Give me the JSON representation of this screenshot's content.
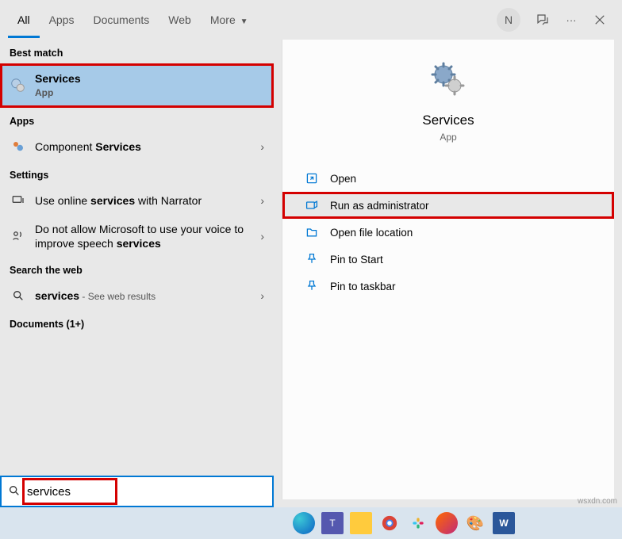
{
  "tabs": {
    "all": "All",
    "apps": "Apps",
    "documents": "Documents",
    "web": "Web",
    "more": "More"
  },
  "avatar_initial": "N",
  "ellipsis": "···",
  "left": {
    "best_match": "Best match",
    "best": {
      "title": "Services",
      "sub": "App"
    },
    "apps_label": "Apps",
    "apps_item": {
      "pre": "Component ",
      "hl": "Services"
    },
    "settings_label": "Settings",
    "settings_1": {
      "pre": "Use online ",
      "hl": "services",
      "post": " with Narrator"
    },
    "settings_2": {
      "pre": "Do not allow Microsoft to use your voice to improve speech ",
      "hl": "services"
    },
    "web_label": "Search the web",
    "web_item": {
      "hl": "services",
      "post": " - See web results"
    },
    "documents_label": "Documents (1+)"
  },
  "detail": {
    "title": "Services",
    "sub": "App",
    "actions": {
      "open": "Open",
      "run_admin": "Run as administrator",
      "open_loc": "Open file location",
      "pin_start": "Pin to Start",
      "pin_taskbar": "Pin to taskbar"
    }
  },
  "search": {
    "value": "services"
  },
  "watermark": "wsxdn.com"
}
